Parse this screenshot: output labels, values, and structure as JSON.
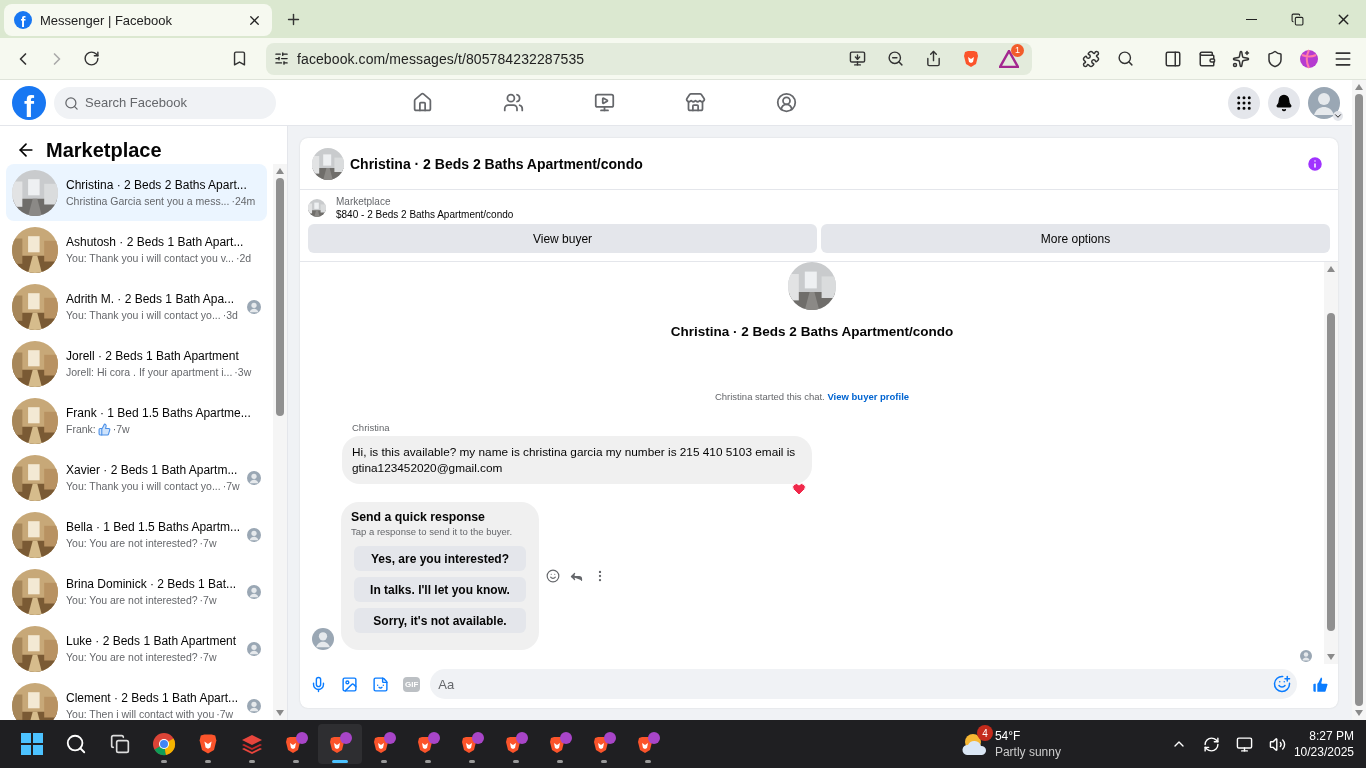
{
  "browser": {
    "tab": {
      "favicon": "f",
      "title": "Messenger | Facebook",
      "selected": true
    },
    "url": "facebook.com/messages/t/805784232287535",
    "rewards_badge": "1"
  },
  "header": {
    "logo": "f",
    "search": {
      "placeholder": "Search Facebook"
    },
    "nav": [
      {
        "kind": "home"
      },
      {
        "kind": "friends"
      },
      {
        "kind": "video"
      },
      {
        "kind": "marketplace"
      },
      {
        "kind": "groups"
      }
    ]
  },
  "sidebar": {
    "title": "Marketplace",
    "conversations": [
      {
        "title": "Christina · 2 Beds 2 Baths Apart...",
        "preview": "Christina Garcia sent you a mess...",
        "time": "·24m",
        "selected": true,
        "sticker": false,
        "seen": false
      },
      {
        "title": "Ashutosh · 2 Beds 1 Bath Apart...",
        "preview": "You: Thank you i will contact you v...",
        "time": "·2d",
        "selected": false,
        "sticker": false,
        "seen": false
      },
      {
        "title": "Adrith M. · 2 Beds 1 Bath Apa...",
        "preview": "You: Thank you i will contact yo...",
        "time": "·3d",
        "selected": false,
        "sticker": false,
        "seen": true
      },
      {
        "title": "Jorell · 2 Beds 1 Bath Apartment",
        "preview": "Jorell: Hi cora . If your apartment i...",
        "time": "·3w",
        "selected": false,
        "sticker": false,
        "seen": false
      },
      {
        "title": "Frank · 1 Bed 1.5 Baths Apartme...",
        "preview": "Frank:",
        "time": "·7w",
        "selected": false,
        "sticker": true,
        "seen": false
      },
      {
        "title": "Xavier · 2 Beds 1 Bath Apartm...",
        "preview": "You: Thank you i will contact yo...",
        "time": "·7w",
        "selected": false,
        "sticker": false,
        "seen": true
      },
      {
        "title": "Bella · 1 Bed 1.5 Baths Apartm...",
        "preview": "You: You are not interested?",
        "time": "·7w",
        "selected": false,
        "sticker": false,
        "seen": true
      },
      {
        "title": "Brina Dominick · 2 Beds 1 Bat...",
        "preview": "You: You are not interested?",
        "time": "·7w",
        "selected": false,
        "sticker": false,
        "seen": true
      },
      {
        "title": "Luke · 2 Beds 1 Bath Apartment",
        "preview": "You: You are not interested?",
        "time": "·7w",
        "selected": false,
        "sticker": false,
        "seen": true
      },
      {
        "title": "Clement · 2 Beds 1 Bath Apart...",
        "preview": "You: Then i will contact with you",
        "time": "·7w",
        "selected": false,
        "sticker": false,
        "seen": true
      }
    ]
  },
  "chat": {
    "title": "Christina · 2 Beds 2 Baths Apartment/condo",
    "listing": {
      "label": "Marketplace",
      "price_title": "$840 - 2 Beds 2 Baths Apartment/condo",
      "buttons": [
        "View buyer",
        "More options"
      ]
    },
    "intro": {
      "title": "Christina · 2 Beds 2 Baths Apartment/condo",
      "started": "Christina started this chat.",
      "link": "View buyer profile"
    },
    "message": {
      "sender": "Christina",
      "text": "Hi, is this available? my name is christina garcia my number is 215 410 5103 email is gtina123452020@gmail.com",
      "reacted": true
    },
    "quick_response": {
      "title": "Send a quick response",
      "subtitle": "Tap a response to send it to the buyer.",
      "options": [
        "Yes, are you interested?",
        "In talks. I'll let you know.",
        "Sorry, it's not available."
      ]
    },
    "composer": {
      "gif": "GIF",
      "placeholder": "Aa"
    }
  },
  "taskbar": {
    "weather": {
      "badge": "4",
      "temperature": "54°F",
      "condition": "Partly sunny"
    },
    "apps": [
      {
        "kind": "start",
        "selected": false
      },
      {
        "kind": "search",
        "selected": false
      },
      {
        "kind": "taskview",
        "selected": false
      },
      {
        "kind": "chrome",
        "selected": false
      },
      {
        "kind": "brave",
        "selected": false
      },
      {
        "kind": "stack",
        "selected": false
      },
      {
        "kind": "brave-profile",
        "selected": false
      },
      {
        "kind": "brave-profile",
        "selected": true
      },
      {
        "kind": "brave-profile",
        "selected": false
      },
      {
        "kind": "brave-profile",
        "selected": false
      },
      {
        "kind": "brave-profile",
        "selected": false
      },
      {
        "kind": "brave-profile",
        "selected": false
      },
      {
        "kind": "brave-profile",
        "selected": false
      },
      {
        "kind": "brave-profile",
        "selected": false
      },
      {
        "kind": "brave-profile",
        "selected": false
      }
    ],
    "time": "8:27 PM",
    "date": "10/23/2025"
  }
}
